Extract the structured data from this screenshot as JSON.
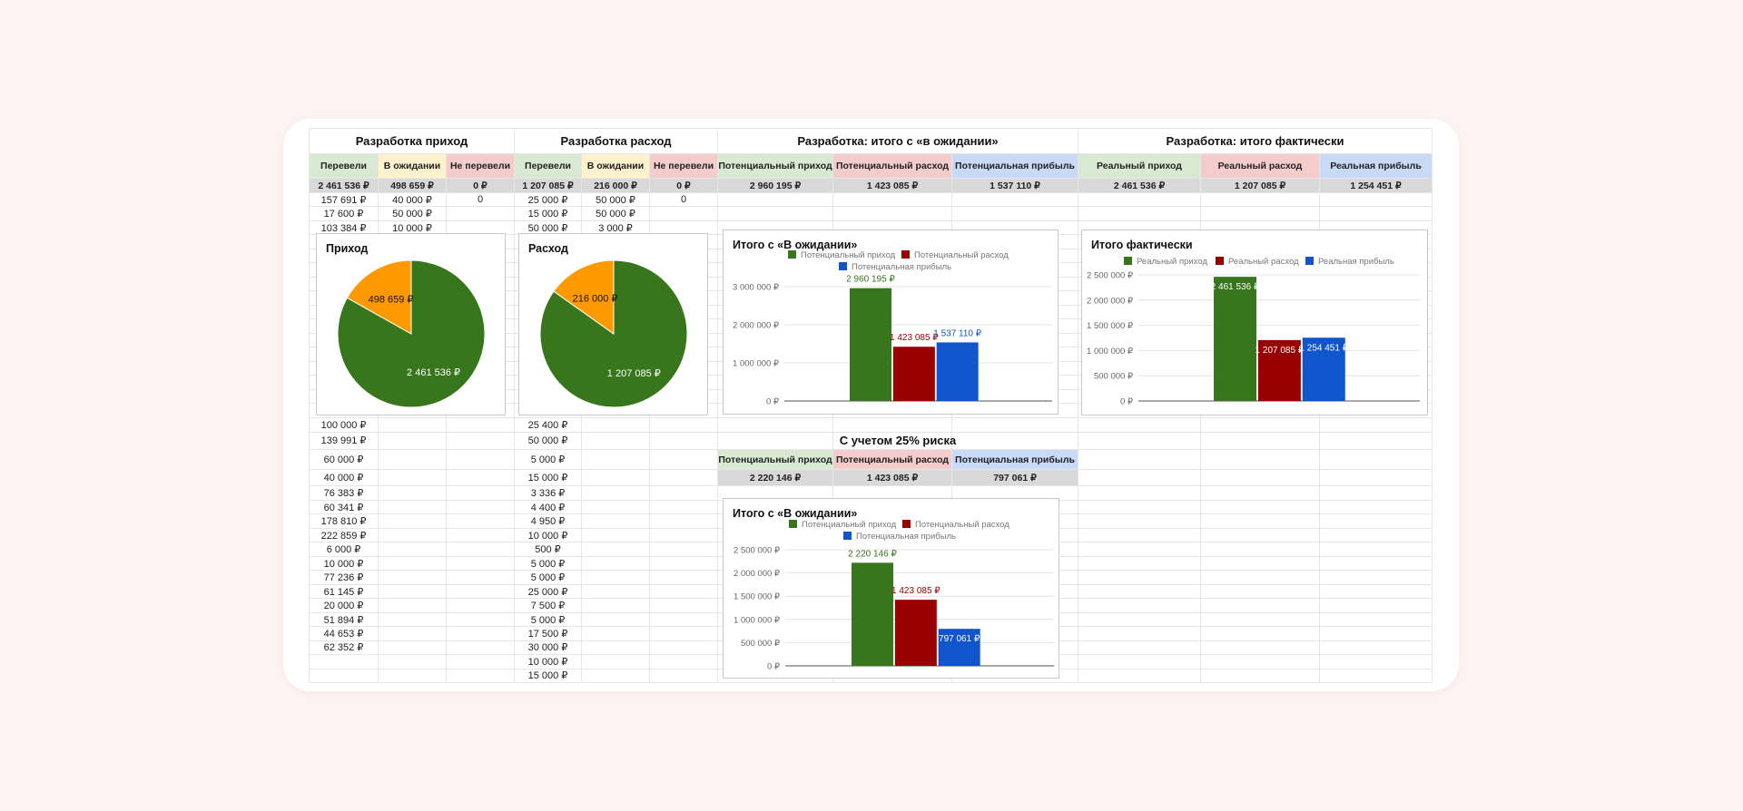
{
  "colors": {
    "green": "#38761d",
    "orange": "#ff9900",
    "red": "#990000",
    "blue": "#1155cc",
    "hdr_green": "#d9ead3",
    "hdr_yellow": "#fff2cc",
    "hdr_red": "#f4cccc",
    "hdr_blue": "#c9daf8",
    "total": "#d9d9d9"
  },
  "sheet": {
    "sections": [
      {
        "title": "Разработка приход",
        "headers": [
          "Перевели",
          "В ожидании",
          "Не перевели"
        ],
        "totals": [
          "2 461 536 ₽",
          "498 659 ₽",
          "0 ₽"
        ]
      },
      {
        "title": "Разработка расход",
        "headers": [
          "Перевели",
          "В ожидании",
          "Не перевели"
        ],
        "totals": [
          "1 207 085 ₽",
          "216 000 ₽",
          "0 ₽"
        ]
      },
      {
        "title": "Разработка: итого с «в ожидании»",
        "headers": [
          "Потенциальный приход",
          "Потенциальный расход",
          "Потенциальная прибыль"
        ],
        "totals": [
          "2 960 195 ₽",
          "1 423 085 ₽",
          "1 537 110 ₽"
        ]
      },
      {
        "title": "Разработка: итого фактически",
        "headers": [
          "Реальный приход",
          "Реальный расход",
          "Реальная прибыль"
        ],
        "totals": [
          "2 461 536 ₽",
          "1 207 085 ₽",
          "1 254 451 ₽"
        ]
      }
    ],
    "income_top": [
      [
        "157 691 ₽",
        "40 000 ₽",
        "0"
      ],
      [
        "17 600 ₽",
        "50 000 ₽",
        ""
      ],
      [
        "103 384 ₽",
        "10 000 ₽",
        ""
      ]
    ],
    "expense_top": [
      [
        "25 000 ₽",
        "50 000 ₽",
        "0"
      ],
      [
        "15 000 ₽",
        "50 000 ₽",
        ""
      ],
      [
        "50 000 ₽",
        "3 000 ₽",
        ""
      ]
    ],
    "income_lower": [
      "100 000 ₽",
      "139 991 ₽",
      "60 000 ₽",
      "40 000 ₽",
      "76 383 ₽",
      "60 341 ₽",
      "178 810 ₽",
      "222 859 ₽",
      "6 000 ₽",
      "10 000 ₽",
      "77 236 ₽",
      "61 145 ₽",
      "20 000 ₽",
      "51 894 ₽",
      "44 653 ₽",
      "62 352 ₽",
      "",
      ""
    ],
    "expense_lower": [
      "25 400 ₽",
      "50 000 ₽",
      "5 000 ₽",
      "15 000 ₽",
      "3 336 ₽",
      "4 400 ₽",
      "4 950 ₽",
      "10 000 ₽",
      "500 ₽",
      "5 000 ₽",
      "5 000 ₽",
      "25 000 ₽",
      "7 500 ₽",
      "5 000 ₽",
      "17 500 ₽",
      "30 000 ₽",
      "10 000 ₽",
      "15 000 ₽"
    ],
    "risk": {
      "title": "С учетом 25% риска",
      "headers": [
        "Потенциальный приход",
        "Потенциальный расход",
        "Потенциальная прибыль"
      ],
      "totals": [
        "2 220 146 ₽",
        "1 423 085 ₽",
        "797 061 ₽"
      ]
    }
  },
  "chart_data": [
    {
      "type": "pie",
      "title": "Приход",
      "slices": [
        {
          "value": 2461536,
          "label": "2 461 536 ₽",
          "color": "#38761d"
        },
        {
          "value": 498659,
          "label": "498 659 ₽",
          "color": "#ff9900"
        }
      ]
    },
    {
      "type": "pie",
      "title": "Расход",
      "slices": [
        {
          "value": 1207085,
          "label": "1 207 085 ₽",
          "color": "#38761d"
        },
        {
          "value": 216000,
          "label": "216 000 ₽",
          "color": "#ff9900"
        }
      ]
    },
    {
      "type": "bar",
      "title": "Итого с «В ожидании»",
      "ylim": [
        0,
        3000000
      ],
      "yticks": [
        "0 ₽",
        "1 000 000 ₽",
        "2 000 000 ₽",
        "3 000 000 ₽"
      ],
      "ytick_values": [
        0,
        1000000,
        2000000,
        3000000
      ],
      "label_position": "above",
      "series": [
        {
          "name": "Потенциальный приход",
          "value": 2960195,
          "label": "2 960 195 ₽",
          "color": "#38761d"
        },
        {
          "name": "Потенциальный расход",
          "value": 1423085,
          "label": "1 423 085 ₽",
          "color": "#990000"
        },
        {
          "name": "Потенциальная прибыль",
          "value": 1537110,
          "label": "1 537 110 ₽",
          "color": "#1155cc"
        }
      ]
    },
    {
      "type": "bar",
      "title": "Итого фактически",
      "ylim": [
        0,
        2500000
      ],
      "yticks": [
        "0 ₽",
        "500 000 ₽",
        "1 000 000 ₽",
        "1 500 000 ₽",
        "2 000 000 ₽",
        "2 500 000 ₽"
      ],
      "ytick_values": [
        0,
        500000,
        1000000,
        1500000,
        2000000,
        2500000
      ],
      "label_position": "inside",
      "series": [
        {
          "name": "Реальный приход",
          "value": 2461536,
          "label": "2 461 536 ₽",
          "color": "#38761d"
        },
        {
          "name": "Реальный расход",
          "value": 1207085,
          "label": "1 207 085 ₽",
          "color": "#990000"
        },
        {
          "name": "Реальная прибыль",
          "value": 1254451,
          "label": "1 254 451 ₽",
          "color": "#1155cc"
        }
      ]
    },
    {
      "type": "bar",
      "title": "Итого с «В ожидании»",
      "ylim": [
        0,
        2500000
      ],
      "yticks": [
        "0 ₽",
        "500 000 ₽",
        "1 000 000 ₽",
        "1 500 000 ₽",
        "2 000 000 ₽",
        "2 500 000 ₽"
      ],
      "ytick_values": [
        0,
        500000,
        1000000,
        1500000,
        2000000,
        2500000
      ],
      "label_position": "mixed",
      "series": [
        {
          "name": "Потенциальный приход",
          "value": 2220146,
          "label": "2 220 146 ₽",
          "color": "#38761d"
        },
        {
          "name": "Потенциальный расход",
          "value": 1423085,
          "label": "1 423 085 ₽",
          "color": "#990000"
        },
        {
          "name": "Потенциальная прибыль",
          "value": 797061,
          "label": "797 061 ₽",
          "color": "#1155cc"
        }
      ]
    }
  ]
}
